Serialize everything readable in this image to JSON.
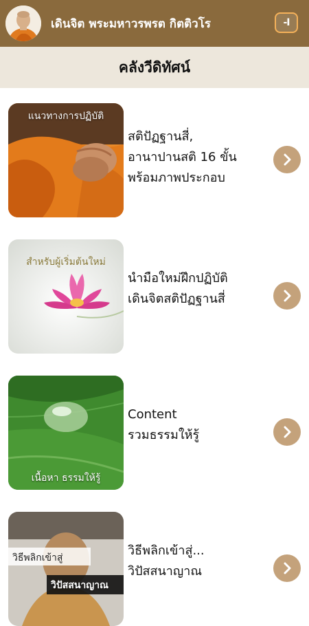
{
  "header": {
    "title": "เดินจิต พระมหาวรพรต กิตติวโร",
    "menu_glyph": "-I"
  },
  "section": {
    "title": "คลังวีดิทัศน์"
  },
  "items": [
    {
      "thumb_caption": "แนวทางการปฏิบัติ",
      "lines": [
        "สติปัฏฐานสี่,",
        "อานาปานสติ 16 ขั้น",
        "พร้อมภาพประกอบ"
      ],
      "icon": "chevron-right-icon"
    },
    {
      "thumb_caption": "สำหรับผู้เริ่มต้นใหม่",
      "lines": [
        "นำมือใหม่ฝึกปฏิบัติ",
        "เดินจิตสติปัฏฐานสี่"
      ],
      "icon": "chevron-right-icon"
    },
    {
      "thumb_caption": "เนื้อหา ธรรมให้รู้",
      "lines": [
        "Content",
        "รวมธรรมให้รู้"
      ],
      "icon": "chevron-right-icon"
    },
    {
      "thumb_caption_1": "วิธีพลิกเข้าสู่",
      "thumb_caption_2": "วิปัสสนาญาณ",
      "lines": [
        "วิธีพลิกเข้าสู่...",
        "วิปัสสนาญาณ"
      ],
      "icon": "chevron-right-icon"
    }
  ],
  "colors": {
    "topbar": "#8a6a3d",
    "subheader": "#ede7dc",
    "chevron": "#c4a27b",
    "menu_border": "#f6b25a"
  }
}
